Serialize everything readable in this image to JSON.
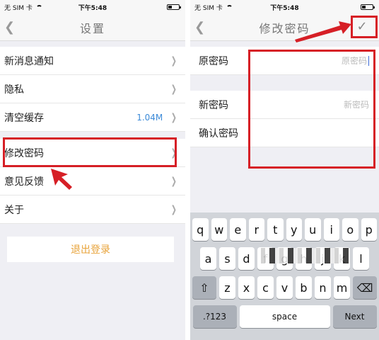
{
  "status": {
    "carrier": "无 SIM 卡",
    "time": "下午5:48"
  },
  "left": {
    "title": "设置",
    "back_icon": "chevron-left-icon",
    "items": [
      {
        "label": "新消息通知",
        "value": ""
      },
      {
        "label": "隐私",
        "value": ""
      },
      {
        "label": "清空缓存",
        "value": "1.04M"
      },
      {
        "label": "修改密码",
        "value": ""
      },
      {
        "label": "意见反馈",
        "value": ""
      },
      {
        "label": "关于",
        "value": ""
      }
    ],
    "logout": "退出登录"
  },
  "right": {
    "title": "修改密码",
    "back_icon": "chevron-left-icon",
    "confirm_icon": "checkmark-icon",
    "fields": [
      {
        "label": "原密码",
        "placeholder": "原密码"
      },
      {
        "label": "新密码",
        "placeholder": "新密码"
      },
      {
        "label": "确认密码",
        "placeholder": ""
      }
    ]
  },
  "keyboard": {
    "row1": [
      "q",
      "w",
      "e",
      "r",
      "t",
      "y",
      "u",
      "i",
      "o",
      "p"
    ],
    "row2": [
      "a",
      "s",
      "d",
      "f",
      "g",
      "h",
      "j",
      "k",
      "l"
    ],
    "row3": [
      "z",
      "x",
      "c",
      "v",
      "b",
      "n",
      "m"
    ],
    "num": ".?123",
    "space": "space",
    "next": "Next"
  },
  "colors": {
    "annotation": "#d61f26",
    "accent": "#3d8bd8",
    "logout": "#e8a33a"
  }
}
